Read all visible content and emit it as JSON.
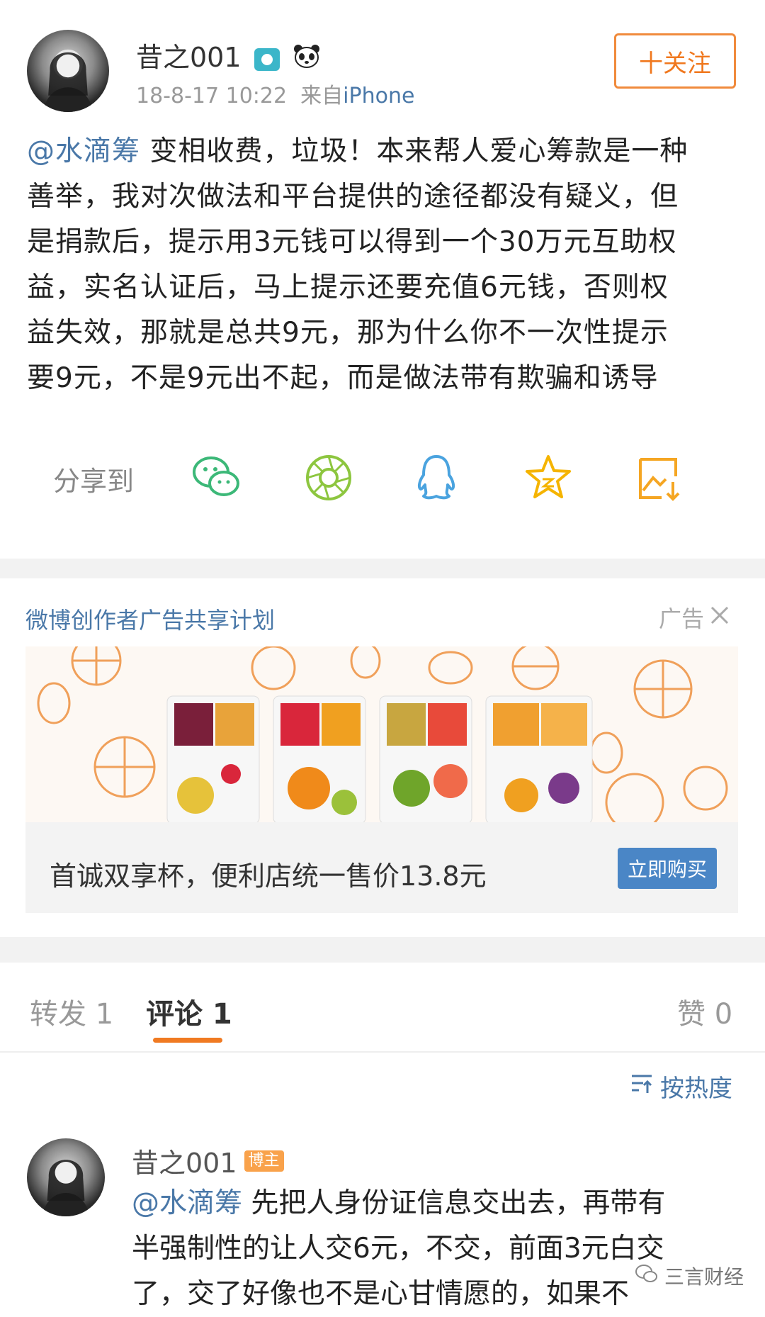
{
  "post": {
    "username": "昔之001",
    "timestamp": "18-8-17 10:22",
    "source_prefix": "来自",
    "source": "iPhone",
    "follow_label": "十关注",
    "mention": "@水滴筹",
    "lines": [
      " 变相收费，垃圾！本来帮人爱心筹款是一种",
      "善举，我对次做法和平台提供的途径都没有疑义，但",
      "是捐款后，提示用3元钱可以得到一个30万元互助权",
      "益，实名认证后，马上提示还要充值6元钱，否则权",
      "益失效，那就是总共9元，那为什么你不一次性提示",
      "要9元，不是9元出不起，而是做法带有欺骗和诱导"
    ]
  },
  "share": {
    "label": "分享到",
    "icons": [
      "wechat-icon",
      "moments-icon",
      "qq-icon",
      "favorite-icon",
      "save-image-icon"
    ]
  },
  "ad": {
    "title": "微博创作者广告共享计划",
    "tag": "广告",
    "description": "首诚双享杯，便利店统一售价13.8元",
    "buy_label": "立即购买"
  },
  "tabs": {
    "repost": "转发 1",
    "comment": "评论 1",
    "like": "赞 0"
  },
  "sort_label": "按热度",
  "comment": {
    "username": "昔之001",
    "badge": "博主",
    "mention": "@水滴筹",
    "lines": [
      " 先把人身份证信息交出去，再带有",
      "半强制性的让人交6元，不交，前面3元白交",
      "了，交了好像也不是心甘情愿的，如果不"
    ]
  },
  "watermark": "三言财经",
  "colors": {
    "accent_orange": "#f07a22",
    "link_blue": "#4a78a8",
    "button_blue": "#4a86c6"
  }
}
